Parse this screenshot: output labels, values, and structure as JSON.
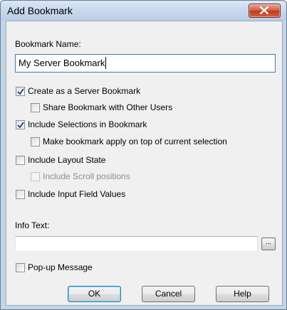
{
  "window": {
    "title": "Add Bookmark"
  },
  "form": {
    "name_label": "Bookmark Name:",
    "name_value": "My Server Bookmark",
    "checkboxes": [
      {
        "label": "Create as a Server Bookmark",
        "checked": true,
        "enabled": true
      },
      {
        "label": "Share Bookmark with Other Users",
        "checked": false,
        "enabled": true
      },
      {
        "label": "Include Selections in Bookmark",
        "checked": true,
        "enabled": true
      },
      {
        "label": "Make bookmark apply on top of current selection",
        "checked": false,
        "enabled": true
      },
      {
        "label": "Include Layout State",
        "checked": false,
        "enabled": true
      },
      {
        "label": "Include Scroll positions",
        "checked": false,
        "enabled": false
      },
      {
        "label": "Include Input Field Values",
        "checked": false,
        "enabled": true
      }
    ],
    "info_label": "Info Text:",
    "info_value": "",
    "browse_label": "...",
    "popup": {
      "label": "Pop-up Message",
      "checked": false,
      "enabled": true
    }
  },
  "buttons": {
    "ok": "OK",
    "cancel": "Cancel",
    "help": "Help"
  },
  "colors": {
    "check": "#1e3f78",
    "close_button": "#c03b1f",
    "default_button_border": "#3c7fb1"
  }
}
